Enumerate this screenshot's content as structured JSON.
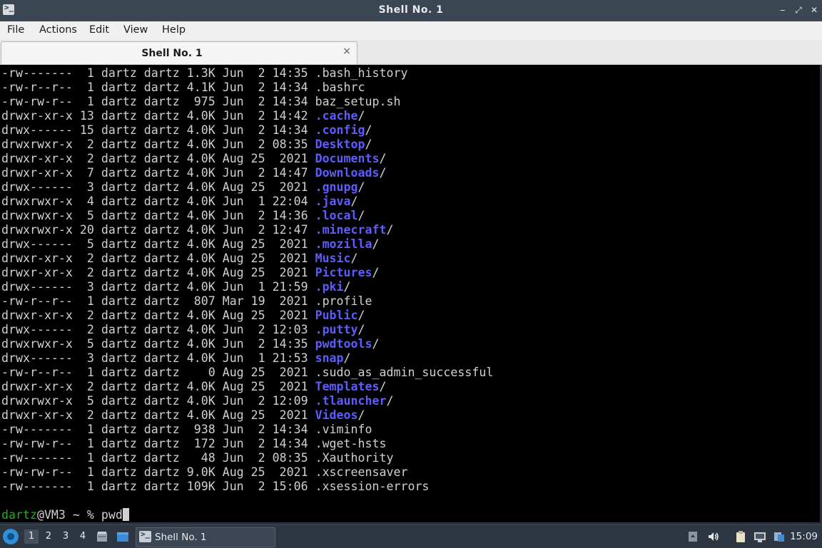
{
  "window": {
    "title": "Shell No. 1",
    "app_icon": ">_",
    "minimize": "‒",
    "restore": "⤢",
    "close": "✕"
  },
  "menu": [
    "File",
    "Actions",
    "Edit",
    "View",
    "Help"
  ],
  "tab": {
    "label": "Shell No. 1",
    "close": "×"
  },
  "terminal": {
    "colors": {
      "background": "#000000",
      "text": "#d0d0d0",
      "directory": "#5c5cff",
      "user": "#18b218"
    },
    "lines": [
      {
        "meta": "-rw-------  1 dartz dartz 1.3K Jun  2 14:35 ",
        "name": ".bash_history",
        "suffix": ""
      },
      {
        "meta": "-rw-r--r--  1 dartz dartz 4.1K Jun  2 14:34 ",
        "name": ".bashrc",
        "suffix": ""
      },
      {
        "meta": "-rw-rw-r--  1 dartz dartz  975 Jun  2 14:34 ",
        "name": "baz_setup.sh",
        "suffix": ""
      },
      {
        "meta": "drwxr-xr-x 13 dartz dartz 4.0K Jun  2 14:42 ",
        "name": ".cache",
        "suffix": "/",
        "dir": true
      },
      {
        "meta": "drwx------ 15 dartz dartz 4.0K Jun  2 14:34 ",
        "name": ".config",
        "suffix": "/",
        "dir": true
      },
      {
        "meta": "drwxrwxr-x  2 dartz dartz 4.0K Jun  2 08:35 ",
        "name": "Desktop",
        "suffix": "/",
        "dir": true
      },
      {
        "meta": "drwxr-xr-x  2 dartz dartz 4.0K Aug 25  2021 ",
        "name": "Documents",
        "suffix": "/",
        "dir": true
      },
      {
        "meta": "drwxr-xr-x  7 dartz dartz 4.0K Jun  2 14:47 ",
        "name": "Downloads",
        "suffix": "/",
        "dir": true
      },
      {
        "meta": "drwx------  3 dartz dartz 4.0K Aug 25  2021 ",
        "name": ".gnupg",
        "suffix": "/",
        "dir": true
      },
      {
        "meta": "drwxrwxr-x  4 dartz dartz 4.0K Jun  1 22:04 ",
        "name": ".java",
        "suffix": "/",
        "dir": true
      },
      {
        "meta": "drwxrwxr-x  5 dartz dartz 4.0K Jun  2 14:36 ",
        "name": ".local",
        "suffix": "/",
        "dir": true
      },
      {
        "meta": "drwxrwxr-x 20 dartz dartz 4.0K Jun  2 12:47 ",
        "name": ".minecraft",
        "suffix": "/",
        "dir": true
      },
      {
        "meta": "drwx------  5 dartz dartz 4.0K Aug 25  2021 ",
        "name": ".mozilla",
        "suffix": "/",
        "dir": true
      },
      {
        "meta": "drwxr-xr-x  2 dartz dartz 4.0K Aug 25  2021 ",
        "name": "Music",
        "suffix": "/",
        "dir": true
      },
      {
        "meta": "drwxr-xr-x  2 dartz dartz 4.0K Aug 25  2021 ",
        "name": "Pictures",
        "suffix": "/",
        "dir": true
      },
      {
        "meta": "drwx------  3 dartz dartz 4.0K Jun  1 21:59 ",
        "name": ".pki",
        "suffix": "/",
        "dir": true
      },
      {
        "meta": "-rw-r--r--  1 dartz dartz  807 Mar 19  2021 ",
        "name": ".profile",
        "suffix": ""
      },
      {
        "meta": "drwxr-xr-x  2 dartz dartz 4.0K Aug 25  2021 ",
        "name": "Public",
        "suffix": "/",
        "dir": true
      },
      {
        "meta": "drwx------  2 dartz dartz 4.0K Jun  2 12:03 ",
        "name": ".putty",
        "suffix": "/",
        "dir": true
      },
      {
        "meta": "drwxrwxr-x  5 dartz dartz 4.0K Jun  2 14:35 ",
        "name": "pwdtools",
        "suffix": "/",
        "dir": true
      },
      {
        "meta": "drwx------  3 dartz dartz 4.0K Jun  1 21:53 ",
        "name": "snap",
        "suffix": "/",
        "dir": true
      },
      {
        "meta": "-rw-r--r--  1 dartz dartz    0 Aug 25  2021 ",
        "name": ".sudo_as_admin_successful",
        "suffix": ""
      },
      {
        "meta": "drwxr-xr-x  2 dartz dartz 4.0K Aug 25  2021 ",
        "name": "Templates",
        "suffix": "/",
        "dir": true
      },
      {
        "meta": "drwxrwxr-x  5 dartz dartz 4.0K Jun  2 12:09 ",
        "name": ".tlauncher",
        "suffix": "/",
        "dir": true
      },
      {
        "meta": "drwxr-xr-x  2 dartz dartz 4.0K Aug 25  2021 ",
        "name": "Videos",
        "suffix": "/",
        "dir": true
      },
      {
        "meta": "-rw-------  1 dartz dartz  938 Jun  2 14:34 ",
        "name": ".viminfo",
        "suffix": ""
      },
      {
        "meta": "-rw-rw-r--  1 dartz dartz  172 Jun  2 14:34 ",
        "name": ".wget-hsts",
        "suffix": ""
      },
      {
        "meta": "-rw-------  1 dartz dartz   48 Jun  2 08:35 ",
        "name": ".Xauthority",
        "suffix": ""
      },
      {
        "meta": "-rw-rw-r--  1 dartz dartz 9.0K Aug 25  2021 ",
        "name": ".xscreensaver",
        "suffix": ""
      },
      {
        "meta": "-rw-------  1 dartz dartz 109K Jun  2 15:06 ",
        "name": ".xsession-errors",
        "suffix": ""
      }
    ],
    "prompt": {
      "user": "dartz",
      "host_path": "@VM3 ~ % ",
      "command": "pwd"
    }
  },
  "taskbar": {
    "workspaces": [
      "1",
      "2",
      "3",
      "4"
    ],
    "active_workspace": "1",
    "task_label": "Shell No. 1",
    "clock": "15:09",
    "tray_icons": [
      "notification-icon",
      "volume-icon",
      "clipboard-icon",
      "network-icon",
      "update-icon"
    ]
  }
}
